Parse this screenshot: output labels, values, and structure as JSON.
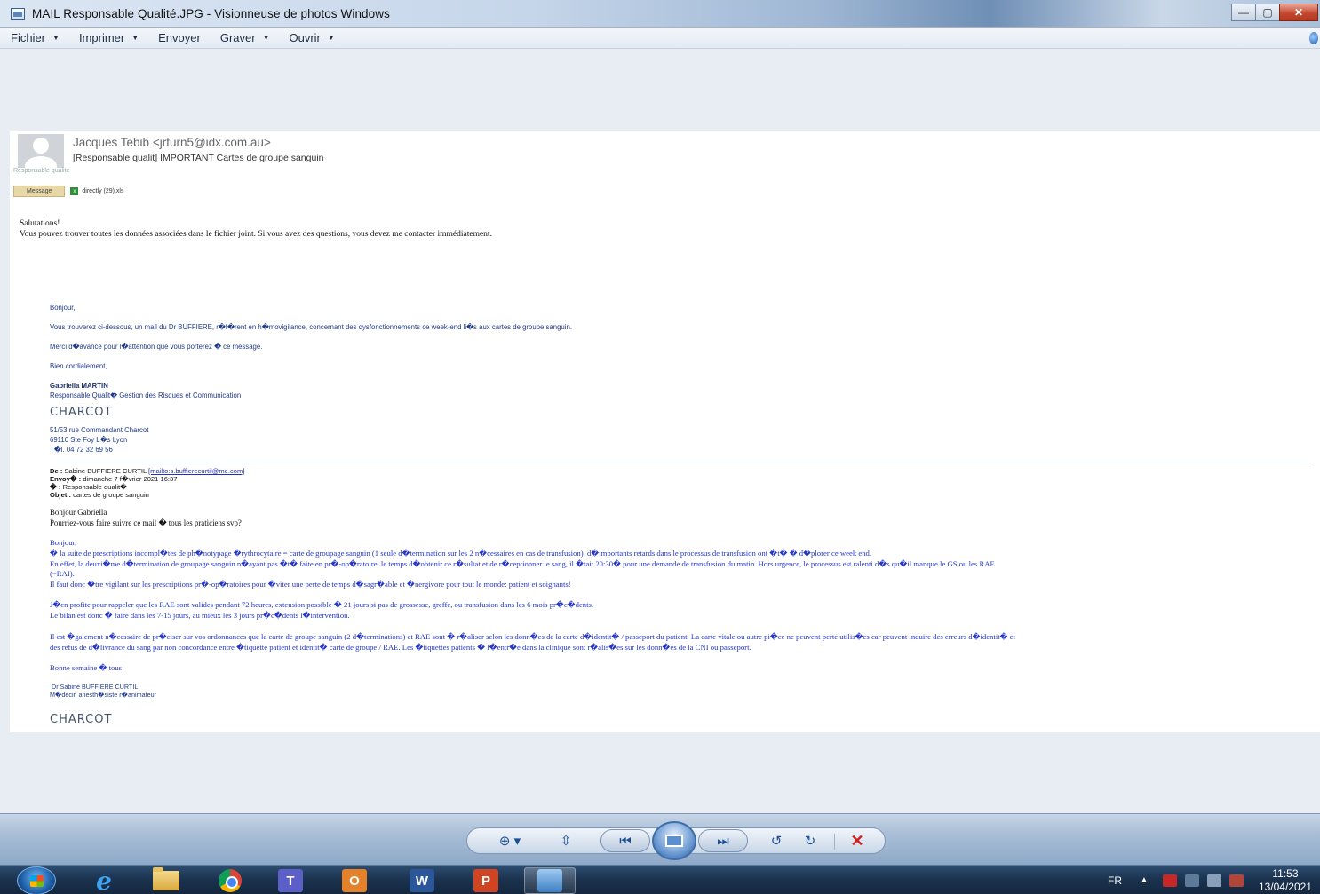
{
  "window": {
    "title": "MAIL Responsable Qualité.JPG - Visionneuse de photos Windows",
    "controls": {
      "minimize": "—",
      "maximize": "▢",
      "close": "✕"
    }
  },
  "menu": {
    "items": [
      {
        "label": "Fichier",
        "has_dropdown": true
      },
      {
        "label": "Imprimer",
        "has_dropdown": true
      },
      {
        "label": "Envoyer",
        "has_dropdown": false
      },
      {
        "label": "Graver",
        "has_dropdown": true
      },
      {
        "label": "Ouvrir",
        "has_dropdown": true
      }
    ],
    "caret": "▼"
  },
  "email": {
    "sender": "Jacques Tebib <jrturn5@idx.com.au>",
    "subject": "[Responsable qualit] IMPORTANT Cartes de groupe sanguin",
    "recipient": "Responsable qualité",
    "message_tab": "Message",
    "attachment": "directly (29).xls",
    "intro_line1": "Salutations!",
    "intro_line2": "Vous pouvez trouver toutes les données associées dans le fichier joint. Si vous avez des questions, vous devez me contacter immédiatement.",
    "fwd": {
      "hello": "Bonjour,",
      "line1": "Vous trouverez ci-dessous, un mail du Dr BUFFIERE, r�f�rent en h�movigilance, concernant des dysfonctionnements ce week-end li�s aux cartes de groupe sanguin.",
      "line2": "Merci d�avance pour l�attention que vous porterez � ce message.",
      "line3": "Bien cordialement,",
      "sig_name": "Gabriella MARTIN",
      "sig_title": "Responsable Qualit� Gestion des Risques et Communication",
      "logo": "CHARCOT",
      "logo_overline": "· · · · · · · ·",
      "addr1": "51/53 rue Commandant Charcot",
      "addr2": "69110 Ste Foy L�s Lyon",
      "addr3": "T�l. 04 72 32 69 56"
    },
    "orig": {
      "from_label": "De :",
      "from_name": "Sabine BUFFIERE CURTIL",
      "from_link": "[mailto:s.buffierecurtil@me.com]",
      "sent_label": "Envoy� :",
      "sent_value": "dimanche 7 f�vrier 2021 16:37",
      "to_label": "� :",
      "to_value": "Responsable qualit�",
      "subj_label": "Objet :",
      "subj_value": "cartes de groupe sanguin",
      "greet1": "Bonjour Gabriella",
      "greet2": "Pourriez-vous faire suivre ce mail � tous les praticiens svp?",
      "b_hello": "Bonjour,",
      "b1": "� la suite de prescriptions incompl�tes de ph�notypage �rythrocytaire = carte de groupage sanguin (1 seule d�termination sur les 2 n�cessaires en cas de transfusion), d�importants retards dans le processus de transfusion ont �t� � d�plorer ce week end.",
      "b2": "En effet, la deuxi�me d�termination de groupage sanguin n�ayant pas �t� faite en pr�-op�ratoire, le temps d�obtenir ce r�sultat et de r�ceptionner le sang, il �tait 20:30� pour une demande de transfusion du matin. Hors urgence, le processus est ralenti d�s qu�il manque le GS ou les RAE",
      "b3": "(=RAI).",
      "b4": "Il faut donc �tre vigilant sur les prescriptions pr�-op�ratoires pour �viter une perte de temps d�sagr�able et �nergivore pour tout le monde: patient et soignants!",
      "b5": "J�en profite pour rappeler que les RAE sont valides pendant 72 heures, extension possible � 21 jours si pas de grossesse, greffe, ou transfusion dans les 6 mois pr�c�dents.",
      "b6": "Le bilan est donc � faire dans les 7-15 jours, au mieux les 3 jours pr�c�dents l�intervention.",
      "b7": "Il est �galement n�cessaire de pr�ciser sur vos ordonnances que la carte de groupe sanguin (2 d�terminations) et RAE sont � r�aliser selon les donn�es de la carte d�identit� / passeport du patient. La carte vitale ou autre pi�ce ne peuvent perte utilis�es car peuvent induire des erreurs d�identit� et",
      "b8": "des refus de d�livrance du sang par non concordance entre �tiquette patient et identit� carte de groupe / RAE. Les �tiquettes patients � l�entr�e dans la clinique sont r�alis�es sur les donn�es de la CNI ou passeport.",
      "b9": "Bonne semaine � tous",
      "sig1": "Dr Sabine BUFFIERE CURTIL",
      "sig2": "M�decin anesth�siste r�animateur",
      "logo": "CHARCOT",
      "logo_overline": "· · · · · · · ·"
    }
  },
  "controls": {
    "zoom": "⊕ ▾",
    "fit": "⇳",
    "prev": "⏮",
    "next": "⏭",
    "rotate_left": "↺",
    "rotate_right": "↻",
    "delete": "✕"
  },
  "taskbar": {
    "ie_glyph": "e",
    "teams_glyph": "T",
    "outlook_glyph": "O",
    "word_glyph": "W",
    "ppt_glyph": "P",
    "lang": "FR",
    "tray_arrow": "▲",
    "time": "11:53",
    "date": "13/04/2021"
  }
}
